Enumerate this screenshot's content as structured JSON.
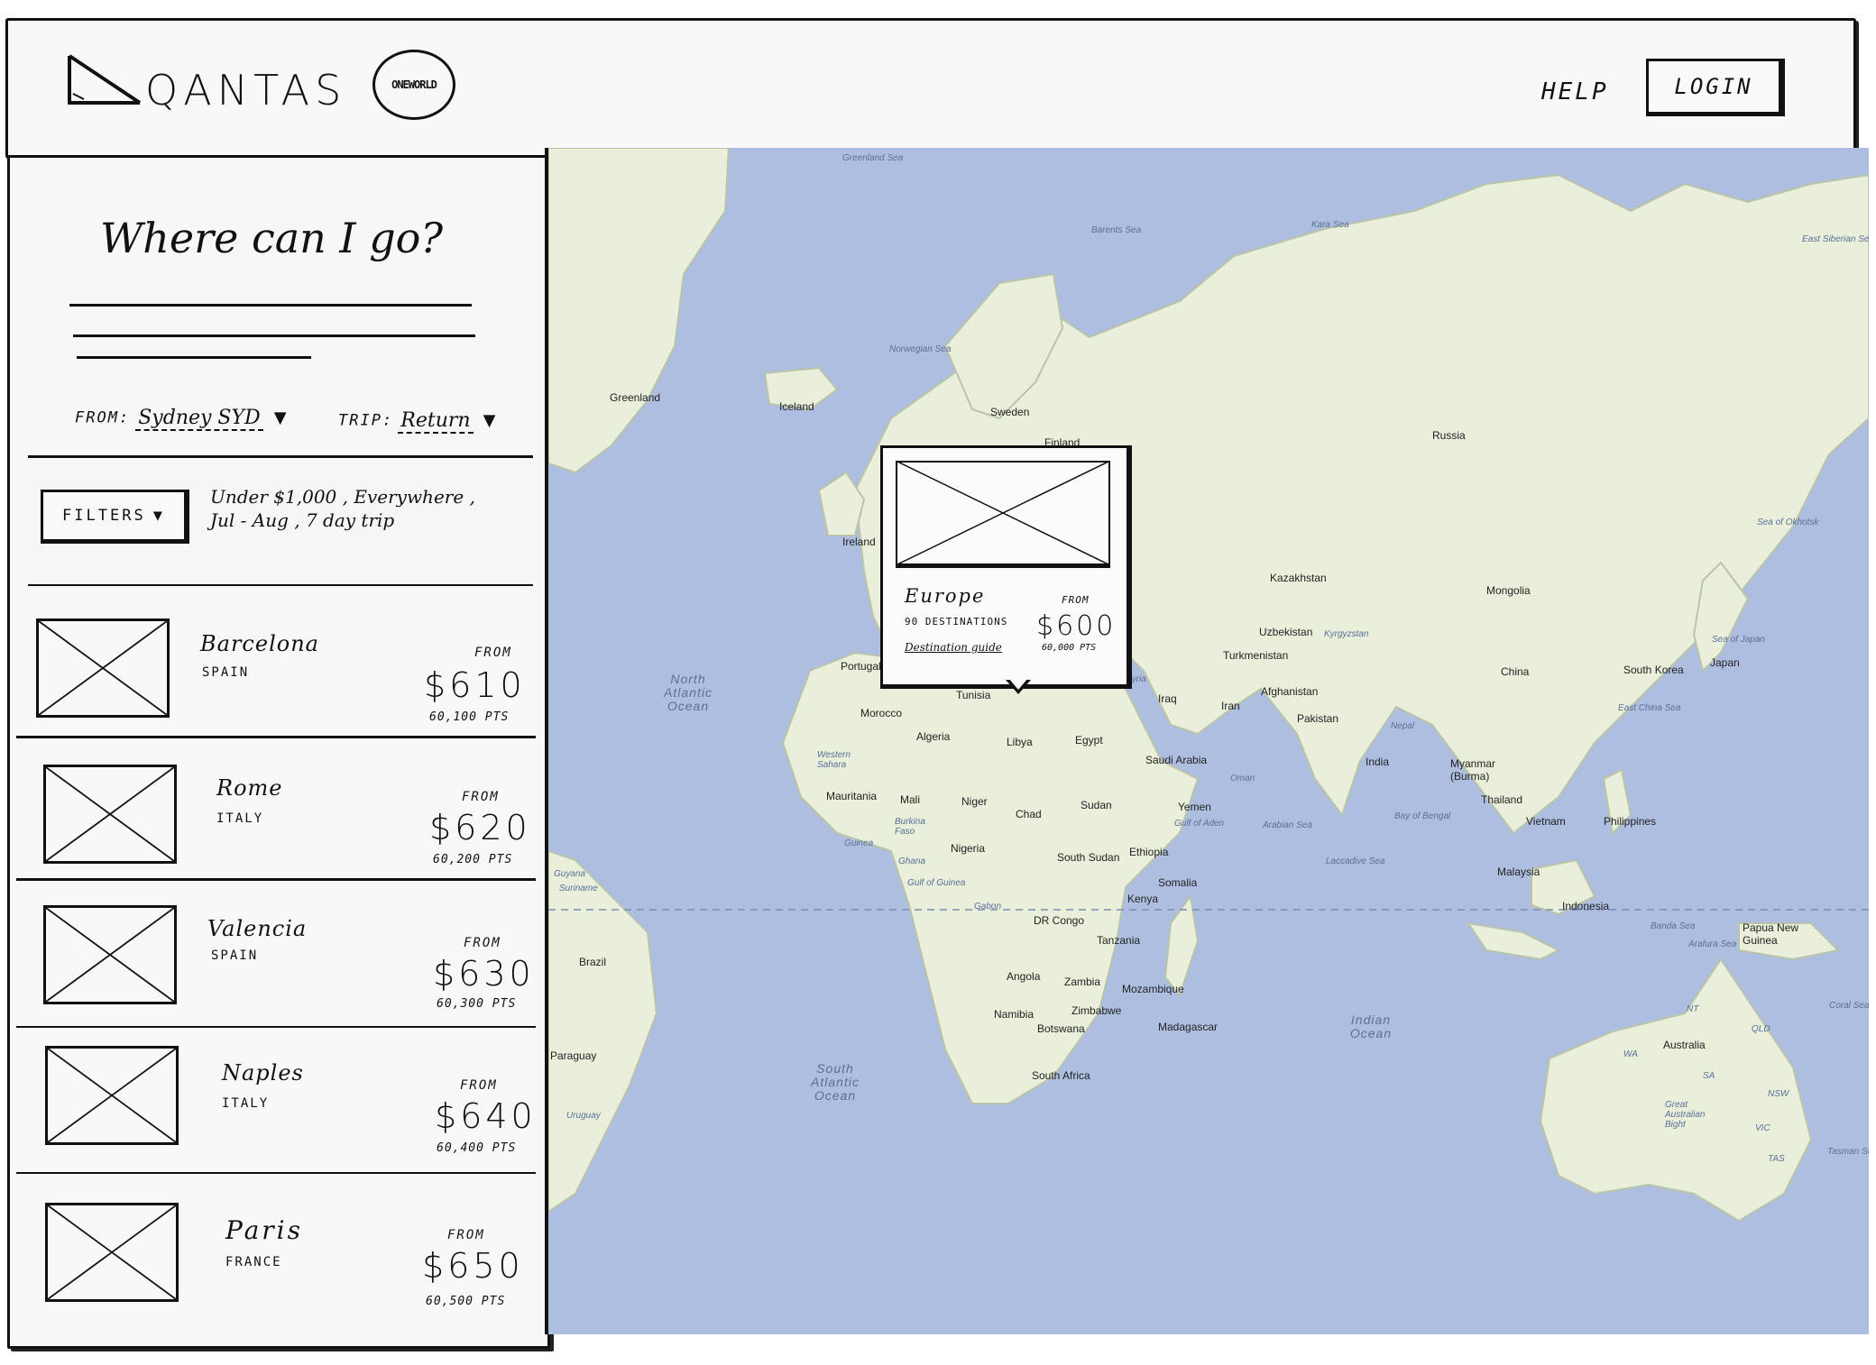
{
  "header": {
    "brand": "QANTAS",
    "alliance_badge": "ONEWORLD",
    "help_label": "HELP",
    "login_label": "LOGIN"
  },
  "search": {
    "title": "Where can I go?",
    "from_label": "FROM:",
    "from_value": "Sydney SYD",
    "trip_label": "TRIP:",
    "trip_value": "Return"
  },
  "filters": {
    "button_label": "FILTERS",
    "summary_line1": "Under $1,000 , Everywhere ,",
    "summary_line2": "Jul - Aug , 7 day trip"
  },
  "results": [
    {
      "name": "Barcelona",
      "country": "SPAIN",
      "from_label": "FROM",
      "price": "$610",
      "points": "60,100 PTS"
    },
    {
      "name": "Rome",
      "country": "ITALY",
      "from_label": "FROM",
      "price": "$620",
      "points": "60,200 PTS"
    },
    {
      "name": "Valencia",
      "country": "SPAIN",
      "from_label": "FROM",
      "price": "$630",
      "points": "60,300 PTS"
    },
    {
      "name": "Naples",
      "country": "ITALY",
      "from_label": "FROM",
      "price": "$640",
      "points": "60,400 PTS"
    },
    {
      "name": "Paris",
      "country": "FRANCE",
      "from_label": "FROM",
      "price": "$650",
      "points": "60,500 PTS"
    }
  ],
  "popover": {
    "region": "Europe",
    "destinations": "90 DESTINATIONS",
    "guide_link": "Destination guide",
    "from_label": "FROM",
    "price": "$600",
    "points": "60,000 PTS"
  },
  "map": {
    "water_color": "#aebee0",
    "land_color": "#e9efdb",
    "labels": {
      "greenland_sea": "Greenland Sea",
      "barents_sea": "Barents Sea",
      "kara_sea": "Kara Sea",
      "east_siberian_sea": "East Siberian Sea",
      "norwegian_sea": "Norwegian Sea",
      "greenland": "Greenland",
      "iceland": "Iceland",
      "sweden": "Sweden",
      "finland": "Finland",
      "russia": "Russia",
      "ireland": "Ireland",
      "portugal": "Portugal",
      "north_atlantic": "North Atlantic Ocean",
      "kazakhstan": "Kazakhstan",
      "mongolia": "Mongolia",
      "sea_of_okhotsk": "Sea of Okhotsk",
      "uzbekistan": "Uzbekistan",
      "kyrgyzstan": "Kyrgyzstan",
      "turkmenistan": "Turkmenistan",
      "sea_of_japan": "Sea of Japan",
      "china": "China",
      "south_korea": "South Korea",
      "japan": "Japan",
      "east_china_sea": "East China Sea",
      "tunisia": "Tunisia",
      "syria": "Syria",
      "iraq": "Iraq",
      "iran": "Iran",
      "afghanistan": "Afghanistan",
      "pakistan": "Pakistan",
      "nepal": "Nepal",
      "morocco": "Morocco",
      "algeria": "Algeria",
      "libya": "Libya",
      "egypt": "Egypt",
      "saudi_arabia": "Saudi Arabia",
      "oman": "Oman",
      "india": "India",
      "myanmar": "Myanmar (Burma)",
      "western_sahara": "Western Sahara",
      "mauritania": "Mauritania",
      "mali": "Mali",
      "niger": "Niger",
      "chad": "Chad",
      "sudan": "Sudan",
      "yemen": "Yemen",
      "gulf_of_aden": "Gulf of Aden",
      "arabian_sea": "Arabian Sea",
      "bay_of_bengal": "Bay of Bengal",
      "thailand": "Thailand",
      "vietnam": "Vietnam",
      "philippines": "Philippines",
      "burkina_faso": "Burkina Faso",
      "guinea": "Guinea",
      "ghana": "Ghana",
      "nigeria": "Nigeria",
      "south_sudan": "South Sudan",
      "ethiopia": "Ethiopia",
      "somalia": "Somalia",
      "laccadive_sea": "Laccadive Sea",
      "malaysia": "Malaysia",
      "gulf_of_guinea": "Gulf of Guinea",
      "gabon": "Gabon",
      "kenya": "Kenya",
      "dr_congo": "DR Congo",
      "indonesia": "Indonesia",
      "banda_sea": "Banda Sea",
      "papua_new_guinea": "Papua New Guinea",
      "arafura_sea": "Arafura Sea",
      "tanzania": "Tanzania",
      "angola": "Angola",
      "zambia": "Zambia",
      "mozambique": "Mozambique",
      "namibia": "Namibia",
      "zimbabwe": "Zimbabwe",
      "botswana": "Botswana",
      "madagascar": "Madagascar",
      "south_africa": "South Africa",
      "indian_ocean": "Indian Ocean",
      "south_atlantic": "South Atlantic Ocean",
      "australia": "Australia",
      "coral_sea": "Coral Sea",
      "great_australian_bight": "Great Australian Bight",
      "tasman_sea": "Tasman Sea",
      "guyana": "Guyana",
      "suriname": "Suriname",
      "brazil": "Brazil",
      "paraguay": "Paraguay",
      "uruguay": "Uruguay",
      "nt": "NT",
      "qld": "QLD",
      "wa": "WA",
      "sa": "SA",
      "nsw": "NSW",
      "vic": "VIC",
      "tas": "TAS"
    }
  }
}
